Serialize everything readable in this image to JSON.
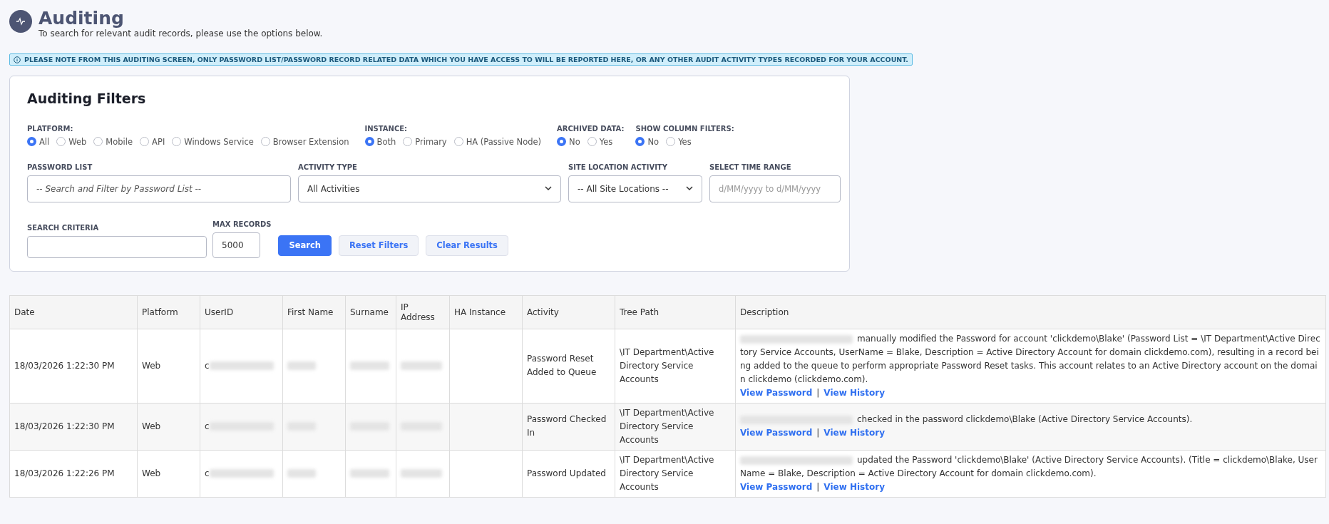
{
  "header": {
    "title": "Auditing",
    "subtitle": "To search for relevant audit records, please use the options below."
  },
  "notice": "PLEASE NOTE FROM THIS AUDITING SCREEN, ONLY PASSWORD LIST/PASSWORD RECORD RELATED DATA WHICH YOU HAVE ACCESS TO WILL BE REPORTED HERE, OR ANY OTHER AUDIT ACTIVITY TYPES RECORDED FOR YOUR ACCOUNT.",
  "filters": {
    "title": "Auditing Filters",
    "radio_groups": [
      {
        "label": "PLATFORM:",
        "options": [
          {
            "label": "All",
            "selected": true
          },
          {
            "label": "Web",
            "selected": false
          },
          {
            "label": "Mobile",
            "selected": false
          },
          {
            "label": "API",
            "selected": false
          },
          {
            "label": "Windows Service",
            "selected": false
          },
          {
            "label": "Browser Extension",
            "selected": false
          }
        ]
      },
      {
        "label": "INSTANCE:",
        "options": [
          {
            "label": "Both",
            "selected": true
          },
          {
            "label": "Primary",
            "selected": false
          },
          {
            "label": "HA (Passive Node)",
            "selected": false
          }
        ]
      },
      {
        "label": "ARCHIVED DATA:",
        "options": [
          {
            "label": "No",
            "selected": true
          },
          {
            "label": "Yes",
            "selected": false
          }
        ]
      },
      {
        "label": "SHOW COLUMN FILTERS:",
        "options": [
          {
            "label": "No",
            "selected": true
          },
          {
            "label": "Yes",
            "selected": false
          }
        ]
      }
    ],
    "fields": [
      {
        "kind": "text",
        "label": "PASSWORD LIST",
        "placeholder": "-- Search and Filter by Password List --"
      },
      {
        "kind": "select",
        "label": "ACTIVITY TYPE",
        "value": "All Activities"
      },
      {
        "kind": "select",
        "label": "SITE LOCATION ACTIVITY",
        "value": "-- All Site Locations --"
      },
      {
        "kind": "date",
        "label": "SELECT TIME RANGE",
        "placeholder": "d/MM/yyyy to d/MM/yyyy"
      }
    ],
    "search_criteria": {
      "label": "SEARCH CRITERIA"
    },
    "max_records": {
      "label": "MAX RECORDS",
      "value": "5000"
    },
    "buttons": [
      {
        "kind": "primary",
        "label": "Search"
      },
      {
        "kind": "secondary",
        "label": "Reset Filters"
      },
      {
        "kind": "secondary",
        "label": "Clear Results"
      }
    ]
  },
  "table": {
    "columns": [
      "Date",
      "Platform",
      "UserID",
      "First Name",
      "Surname",
      "IP Address",
      "HA Instance",
      "Activity",
      "Tree Path",
      "Description"
    ],
    "rows": [
      {
        "date": "18/03/2026 1:22:30 PM",
        "platform": "Web",
        "userid": "c",
        "activity": "Password Reset Added to Queue",
        "tree_path": "\\IT Department\\Active Directory Service Accounts",
        "description": "manually modified the Password for account 'clickdemo\\Blake' (Password List = \\IT Department\\Active Directory Service Accounts, UserName = Blake, Description = Active Directory Account for domain clickdemo.com), resulting in a record being added to the queue to perform appropriate Password Reset tasks. This account relates to an Active Directory account on the domain clickdemo (clickdemo.com).",
        "links": [
          "View Password",
          "View History"
        ],
        "separator": "|"
      },
      {
        "date": "18/03/2026 1:22:30 PM",
        "platform": "Web",
        "userid": "c",
        "activity": "Password Checked In",
        "tree_path": "\\IT Department\\Active Directory Service Accounts",
        "description": "checked in the password clickdemo\\Blake (Active Directory Service Accounts).",
        "links": [
          "View Password",
          "View History"
        ],
        "separator": "|"
      },
      {
        "date": "18/03/2026 1:22:26 PM",
        "platform": "Web",
        "userid": "c",
        "activity": "Password Updated",
        "tree_path": "\\IT Department\\Active Directory Service Accounts",
        "description": "updated the Password 'clickdemo\\Blake' (Active Directory Service Accounts). (Title = clickdemo\\Blake, User Name = Blake, Description = Active Directory Account for domain clickdemo.com).",
        "links": [
          "View Password",
          "View History"
        ],
        "separator": "|"
      }
    ]
  }
}
